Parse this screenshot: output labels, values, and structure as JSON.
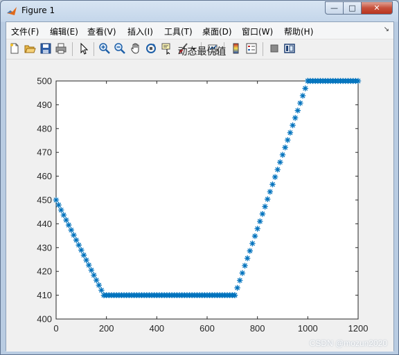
{
  "window": {
    "title": "Figure 1",
    "minimize_glyph": "—",
    "maximize_glyph": "□",
    "close_glyph": "✕"
  },
  "menu": {
    "items": [
      "文件(F)",
      "编辑(E)",
      "查看(V)",
      "插入(I)",
      "工具(T)",
      "桌面(D)",
      "窗口(W)",
      "帮助(H)"
    ],
    "overflow_glyph": "↘"
  },
  "toolbar": {
    "icons": [
      "new-figure-icon",
      "open-file-icon",
      "save-icon",
      "print-icon",
      "edit-plot-arrow-icon",
      "zoom-in-icon",
      "zoom-out-icon",
      "pan-hand-icon",
      "rotate-3d-icon",
      "data-cursor-icon",
      "brush-icon",
      "brush-dropdown-icon",
      "link-plot-icon",
      "colorbar-icon",
      "legend-icon",
      "hide-plot-tools-icon",
      "show-plot-tools-icon"
    ]
  },
  "chart_data": {
    "type": "scatter",
    "title": "动态最优值",
    "marker": "*",
    "color": "#0072bd",
    "xlim": [
      0,
      1200
    ],
    "ylim": [
      400,
      500
    ],
    "xticks": [
      0,
      200,
      400,
      600,
      800,
      1000,
      1200
    ],
    "yticks": [
      400,
      410,
      420,
      430,
      440,
      450,
      460,
      470,
      480,
      490,
      500
    ],
    "xlabel": "",
    "ylabel": "",
    "grid": false,
    "segments": [
      {
        "x_start": 0,
        "x_end": 190,
        "y_start": 450,
        "y_end": 410
      },
      {
        "x_start": 190,
        "x_end": 710,
        "y_start": 410,
        "y_end": 410
      },
      {
        "x_start": 710,
        "x_end": 1000,
        "y_start": 410,
        "y_end": 500
      },
      {
        "x_start": 1000,
        "x_end": 1200,
        "y_start": 500,
        "y_end": 500
      }
    ],
    "marker_step_x": 10
  },
  "watermark": "CSDN @mozun2020"
}
